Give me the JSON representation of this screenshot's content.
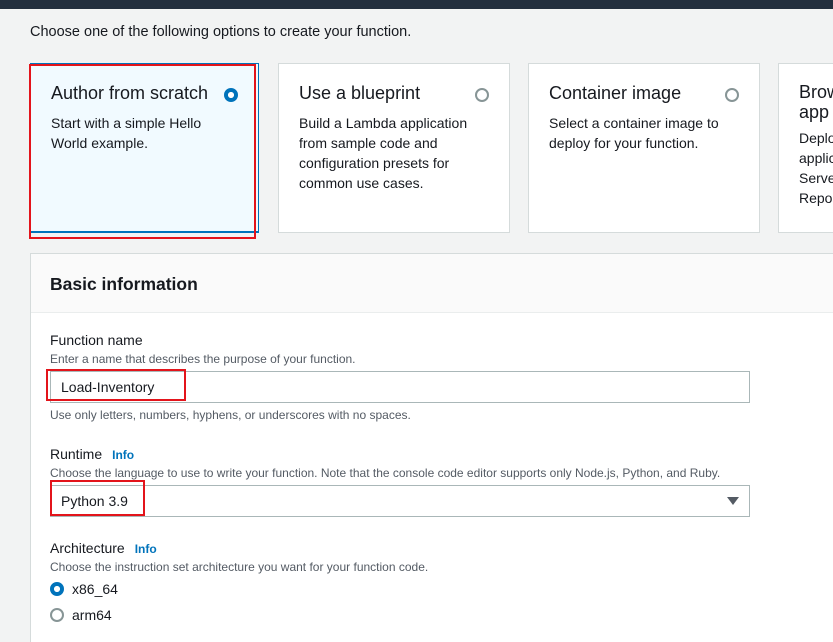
{
  "intro": "Choose one of the following options to create your function.",
  "options": [
    {
      "title": "Author from scratch",
      "desc": "Start with a simple Hello World example.",
      "selected": true
    },
    {
      "title": "Use a blueprint",
      "desc": "Build a Lambda application from sample code and configuration presets for common use cases.",
      "selected": false
    },
    {
      "title": "Container image",
      "desc": "Select a container image to deploy for your function.",
      "selected": false
    },
    {
      "title": "Brow app",
      "desc": "Deplo applic Serve Repos",
      "selected": false
    }
  ],
  "basic_info": {
    "title": "Basic information",
    "function_name": {
      "label": "Function name",
      "desc": "Enter a name that describes the purpose of your function.",
      "value": "Load-Inventory",
      "constraint": "Use only letters, numbers, hyphens, or underscores with no spaces."
    },
    "runtime": {
      "label": "Runtime",
      "info": "Info",
      "desc": "Choose the language to use to write your function. Note that the console code editor supports only Node.js, Python, and Ruby.",
      "value": "Python 3.9"
    },
    "architecture": {
      "label": "Architecture",
      "info": "Info",
      "desc": "Choose the instruction set architecture you want for your function code.",
      "options": [
        "x86_64",
        "arm64"
      ],
      "selected": "x86_64"
    }
  },
  "colors": {
    "accent": "#0073bb",
    "highlight": "#e3141b",
    "topbar": "#232f3e"
  }
}
